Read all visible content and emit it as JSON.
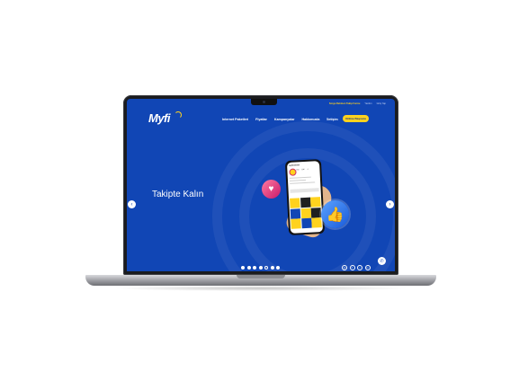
{
  "topbar": {
    "links": [
      "Sorgu Rehinen Takip Formu",
      "Yardım",
      "Giriş Yap"
    ]
  },
  "logo": {
    "text": "Myfi"
  },
  "nav": {
    "items": [
      "Internet Paketleri",
      "Fiyatlar",
      "Kampanyalar",
      "Hakkımızda",
      "İletişim"
    ],
    "cta_label": "Online Başvuru"
  },
  "hero": {
    "headline": "Takipte Kalın",
    "slide_count": 7,
    "active_slide": 5
  },
  "phone_mock": {
    "profile_name": "myfinternet",
    "stats": [
      "153",
      "18K",
      "4"
    ]
  },
  "icons": {
    "prev": "chevron-left-icon",
    "next": "chevron-right-icon",
    "heart": "heart-icon",
    "thumb": "thumbs-up-icon",
    "call": "phone-icon",
    "social": [
      "instagram-icon",
      "facebook-icon",
      "twitter-icon",
      "linkedin-icon"
    ]
  },
  "colors": {
    "brand_blue": "#1146b5",
    "accent_yellow": "#ffd21e",
    "laptop_body": "#1b1c1f"
  }
}
